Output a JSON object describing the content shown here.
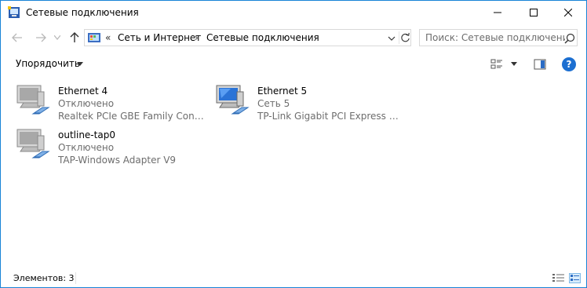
{
  "window": {
    "title": "Сетевые подключения",
    "app_icon": "network-connections-icon",
    "accent_color": "#1883d7"
  },
  "caption": {
    "minimize_icon": "minimize-icon",
    "maximize_icon": "maximize-icon",
    "close_icon": "close-icon"
  },
  "address": {
    "overflow": "«",
    "parts": [
      "Сеть и Интернет",
      "Сетевые подключения"
    ],
    "separator": "›"
  },
  "search": {
    "placeholder": "Поиск: Сетевые подключения"
  },
  "toolbar": {
    "organize_label": "Упорядочить",
    "help_label": "?"
  },
  "connections": [
    {
      "name": "Ethernet 4",
      "status": "Отключено",
      "device": "Realtek PCIe GBE Family Controll...",
      "connected": false
    },
    {
      "name": "Ethernet 5",
      "status": "Сеть 5",
      "device": "TP-Link Gigabit PCI Express Adap...",
      "connected": true
    },
    {
      "name": "outline-tap0",
      "status": "Отключено",
      "device": "TAP-Windows Adapter V9",
      "connected": false
    }
  ],
  "statusbar": {
    "count_label": "Элементов: 3"
  }
}
